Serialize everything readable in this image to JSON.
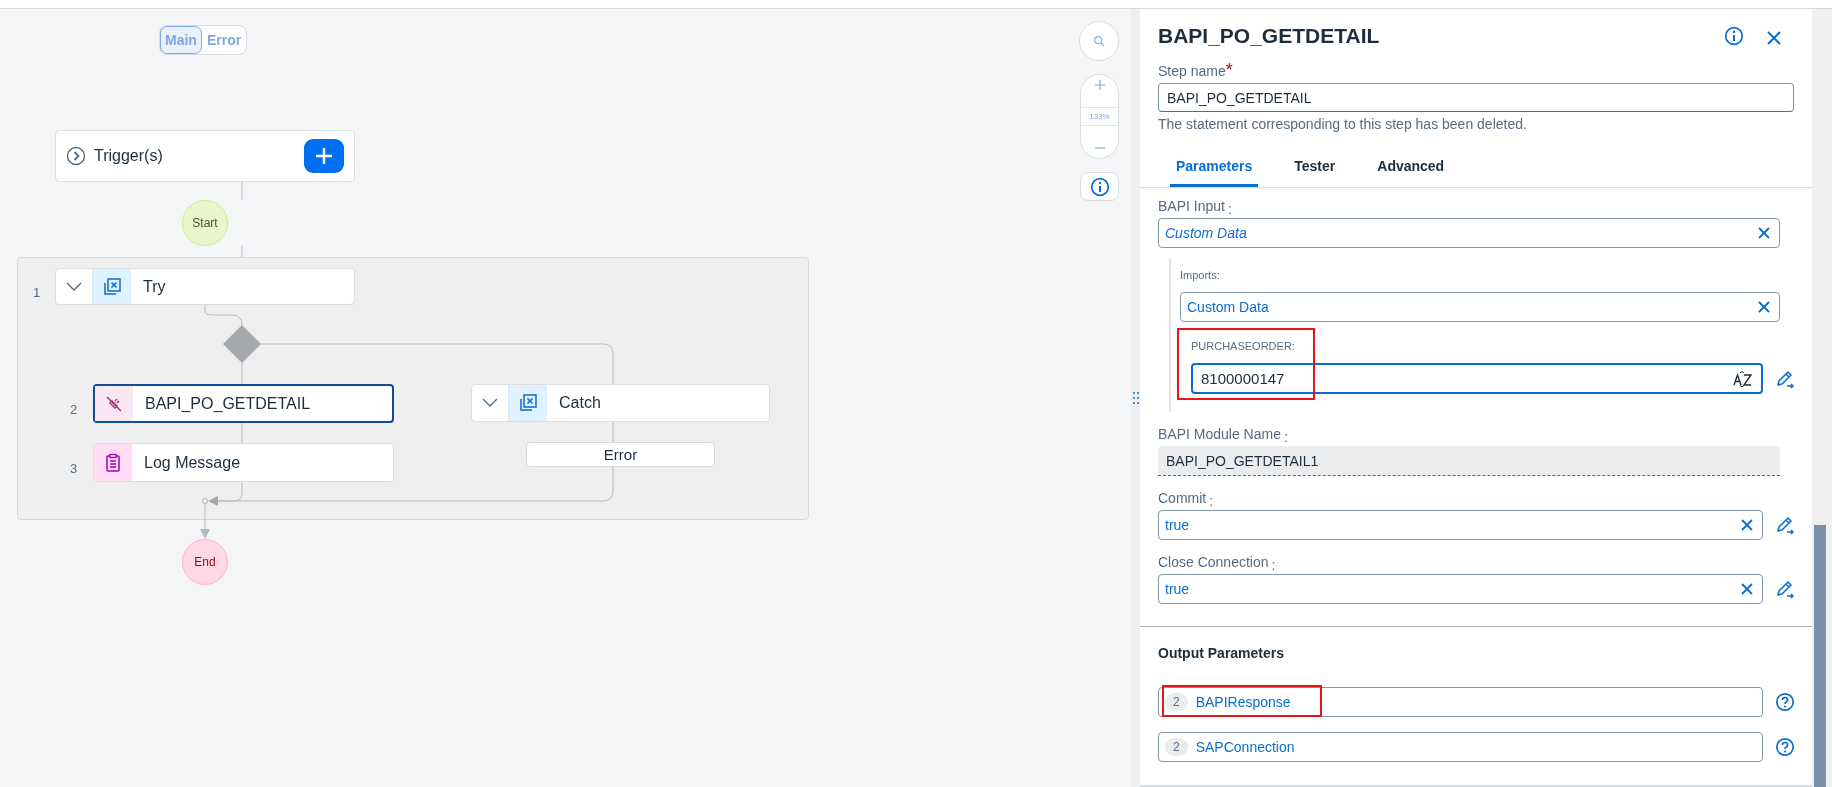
{
  "canvas": {
    "view_toggle": [
      {
        "label": "Main",
        "selected": true
      },
      {
        "label": "Error",
        "selected": false
      }
    ],
    "trigger": {
      "label": "Trigger(s)"
    },
    "start": "Start",
    "end": "End",
    "steps": [
      {
        "number": "1",
        "kind": "try",
        "label": "Try",
        "selected": false
      },
      {
        "number": "2",
        "kind": "bapi",
        "label": "BAPI_PO_GETDETAIL",
        "selected": true
      },
      {
        "number": "3",
        "kind": "log",
        "label": "Log Message",
        "selected": false
      }
    ],
    "catch": {
      "label": "Catch",
      "error_label": "Error"
    }
  },
  "zoom": {
    "reading": "133%"
  },
  "panel": {
    "title": "BAPI_PO_GETDETAIL",
    "step_name": {
      "label": "Step name",
      "required": true,
      "required_mark": "*",
      "value": "BAPI_PO_GETDETAIL"
    },
    "message": "The statement corresponding to this step has been deleted.",
    "tabs": [
      {
        "label": "Parameters",
        "selected": true
      },
      {
        "label": "Tester",
        "selected": false
      },
      {
        "label": "Advanced",
        "selected": false
      }
    ],
    "bapi_input": {
      "label": "BAPI Input",
      "colon": ":",
      "value": "Custom Data"
    },
    "imports": {
      "label": "Imports:",
      "value": "Custom Data"
    },
    "purchase_order": {
      "label": "PURCHASEORDER:",
      "value": "8100000147",
      "highlighted": true
    },
    "module_name": {
      "label": "BAPI Module Name",
      "colon": ":",
      "value": "BAPI_PO_GETDETAIL1"
    },
    "settings": [
      {
        "label": "Commit",
        "colon": ":",
        "value": "true"
      },
      {
        "label": "Close Connection",
        "colon": ":",
        "value": "true"
      }
    ],
    "output": {
      "title": "Output Parameters",
      "items": [
        {
          "count": "2",
          "name": "BAPIResponse",
          "highlighted": true
        },
        {
          "count": "2",
          "name": "SAPConnection",
          "highlighted": false
        }
      ]
    }
  }
}
